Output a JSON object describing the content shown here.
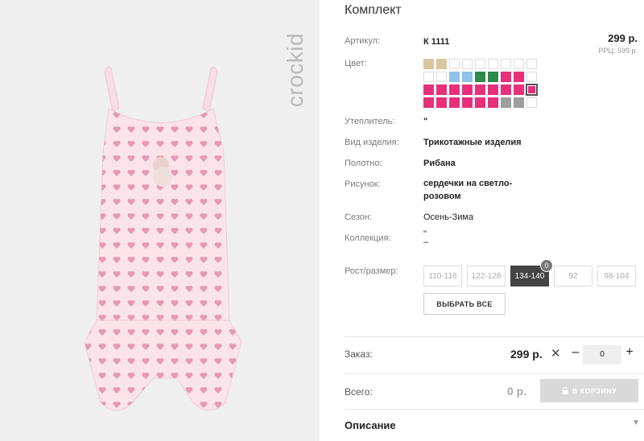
{
  "brand": {
    "logo_text": "crockid"
  },
  "product": {
    "title": "Комплект",
    "article_label": "Артикул:",
    "article_value": "К 1111",
    "price": "299 р.",
    "rrp": "РРЦ: 599 р.",
    "color_label": "Цвет:",
    "swatches": [
      [
        "#d9c6a2",
        "#d9c6a2",
        "#ffffff",
        "#ffffff",
        "#ffffff",
        "#ffffff",
        "#ffffff",
        "#ffffff",
        "#ffffff"
      ],
      [
        "#ffffff",
        "#ffffff",
        "#8fc3ea",
        "#8fc3ea",
        "#2f8a4a",
        "#2f8a4a",
        "#e8307a",
        "#e8307a",
        "#ffffff"
      ],
      [
        "#e8307a",
        "#e8307a",
        "#e8307a",
        "#e8307a",
        "#e8307a",
        "#e8307a",
        "#e8307a",
        "#e8307a",
        "#e8307a"
      ],
      [
        "#e8307a",
        "#e8307a",
        "#e8307a",
        "#e8307a",
        "#e8307a",
        "#e8307a",
        "#9e9e9e",
        "#9e9e9e",
        "#ffffff"
      ]
    ],
    "selected_swatch": "row 3, column 9",
    "attributes": [
      {
        "label": "Утеплитель:",
        "value": "\""
      },
      {
        "label": "Вид изделия:",
        "value": "Трикотажные изделия"
      },
      {
        "label": "Полотно:",
        "value": "Рибана"
      },
      {
        "label": "Рисунок:",
        "value": "сердечки на светло-розовом"
      },
      {
        "label": "Сезон:",
        "value": "Осень-Зима"
      },
      {
        "label": "Коллекция:",
        "value": "\"\n–"
      }
    ],
    "size_label": "Рост/размер:",
    "sizes": [
      "110-116",
      "122-128",
      "134-140",
      "92",
      "98-104"
    ],
    "active_size": "134-140",
    "active_size_count": "0",
    "select_all_label": "ВЫБРАТЬ ВСЕ"
  },
  "order": {
    "label": "Заказ:",
    "price": "299 р.",
    "remove_symbol": "✕",
    "minus": "–",
    "quantity": "0",
    "plus": "+"
  },
  "total": {
    "label": "Всего:",
    "value": "0 р.",
    "cart_button": "В КОРЗИНУ",
    "cart_icon": "lock-icon"
  },
  "description": {
    "label": "Описание",
    "icon": "chevron-down-icon"
  },
  "colors": {
    "accent_pink": "#e8307a",
    "button_disabled": "#d9d9d9",
    "active_size_bg": "#444444"
  }
}
